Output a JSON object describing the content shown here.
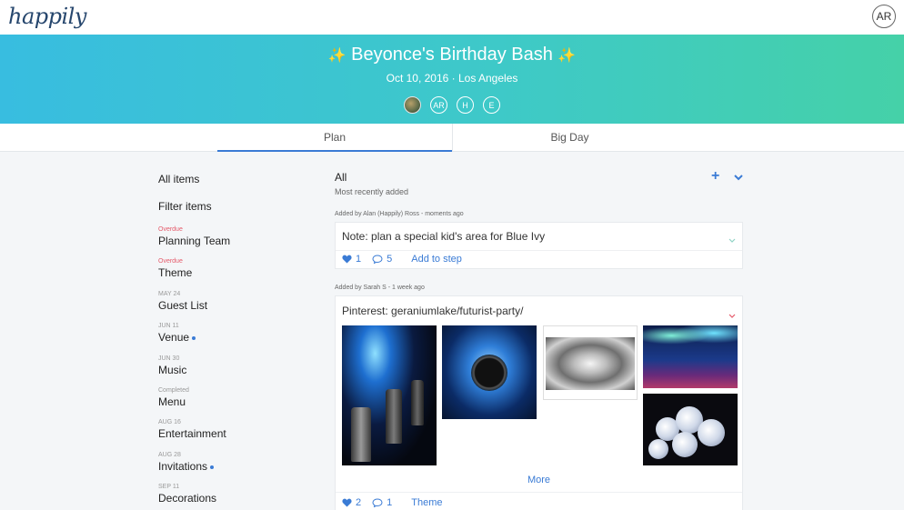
{
  "app": {
    "logo": "happily",
    "user_initials": "AR"
  },
  "event": {
    "title": "Beyonce's Birthday Bash",
    "sparkle": "✨",
    "subtitle": "Oct 10, 2016 · Los Angeles",
    "members": [
      "AR",
      "H",
      "E"
    ]
  },
  "tabs": [
    {
      "label": "Plan",
      "active": true
    },
    {
      "label": "Big Day",
      "active": false
    }
  ],
  "sidebar": {
    "all_items": "All items",
    "filter_items": "Filter items",
    "items": [
      {
        "meta": "Overdue",
        "label": "Planning Team",
        "status": "overdue",
        "dot": false
      },
      {
        "meta": "Overdue",
        "label": "Theme",
        "status": "overdue",
        "dot": false
      },
      {
        "meta": "MAY 24",
        "label": "Guest List",
        "status": "date",
        "dot": false
      },
      {
        "meta": "JUN 11",
        "label": "Venue",
        "status": "date",
        "dot": true
      },
      {
        "meta": "JUN 30",
        "label": "Music",
        "status": "date",
        "dot": false
      },
      {
        "meta": "Completed",
        "label": "Menu",
        "status": "completed",
        "dot": false
      },
      {
        "meta": "AUG 16",
        "label": "Entertainment",
        "status": "date",
        "dot": false
      },
      {
        "meta": "AUG 28",
        "label": "Invitations",
        "status": "date",
        "dot": true
      },
      {
        "meta": "SEP 11",
        "label": "Decorations",
        "status": "date",
        "dot": false
      }
    ]
  },
  "feed": {
    "heading": "All",
    "sort": "Most recently added",
    "posts": [
      {
        "added_by": "Added by Alan (Happily) Ross - moments ago",
        "title": "Note: plan a special kid's area for Blue Ivy",
        "likes": "1",
        "comments": "5",
        "link": "Add to step"
      },
      {
        "added_by": "Added by Sarah S - 1 week ago",
        "title": "Pinterest: geraniumlake/futurist-party/",
        "more": "More",
        "likes": "2",
        "comments": "1",
        "link": "Theme"
      }
    ]
  },
  "colors": {
    "accent": "#3a7bd5",
    "overdue": "#e55a6a",
    "hero_start": "#38bde0",
    "hero_end": "#45d1a8"
  }
}
